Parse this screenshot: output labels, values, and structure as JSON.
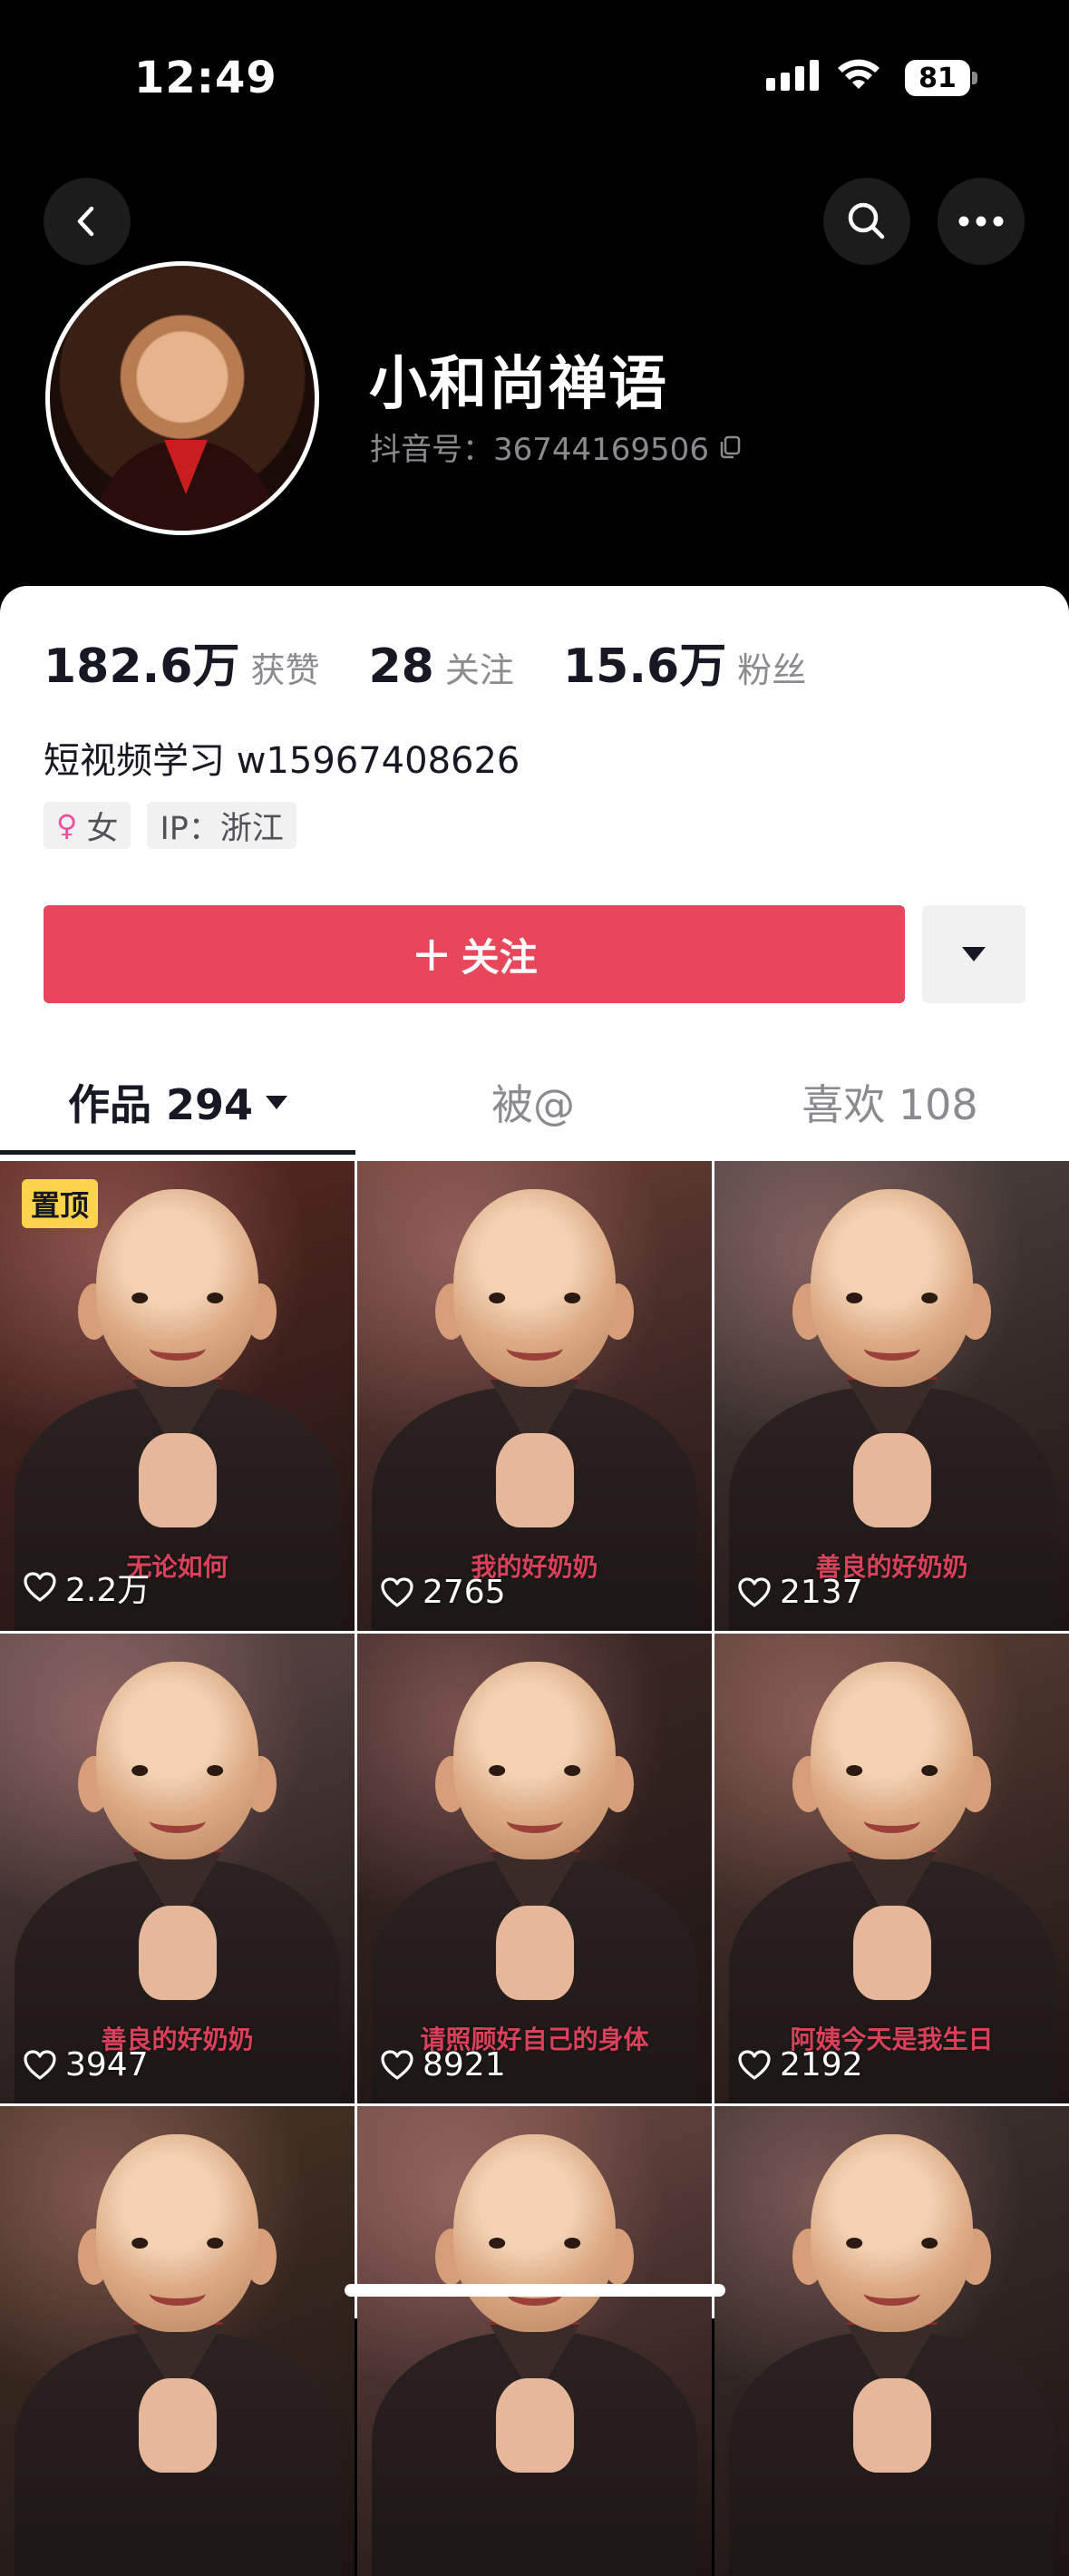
{
  "status_bar": {
    "time": "12:49",
    "battery": "81"
  },
  "profile": {
    "nickname": "小和尚禅语",
    "douyin_id": "抖音号：36744169506",
    "stats": [
      {
        "num": "182.6万",
        "label": "获赞"
      },
      {
        "num": "28",
        "label": "关注"
      },
      {
        "num": "15.6万",
        "label": "粉丝"
      }
    ],
    "bio": "短视频学习 w15967408626",
    "gender_tag": "女",
    "ip_tag": "IP：浙江",
    "follow_label": "关注"
  },
  "tabs": [
    {
      "label": "作品 294"
    },
    {
      "label": "被@"
    },
    {
      "label": "喜欢 108"
    }
  ],
  "videos": [
    {
      "likes": "2.2万",
      "caption": "无论如何",
      "pinned_label": "置顶",
      "bg": "#5a2a22"
    },
    {
      "likes": "2765",
      "caption": "我的好奶奶",
      "bg": "#6b4038"
    },
    {
      "likes": "2137",
      "caption": "善良的好奶奶",
      "bg": "#4e4440"
    },
    {
      "likes": "3947",
      "caption": "善良的好奶奶",
      "bg": "#5e4a48"
    },
    {
      "likes": "8921",
      "caption": "请照顾好自己的身体",
      "bg": "#3e2a26"
    },
    {
      "likes": "2192",
      "caption": "阿姨今天是我生日",
      "bg": "#5a3f34"
    },
    {
      "bg": "#4a3526"
    },
    {
      "bg": "#6e4a44"
    },
    {
      "bg": "#3e3430"
    }
  ],
  "colors": {
    "accent": "#e8465a",
    "pin": "#fcd34d",
    "muted": "#8a8b91"
  }
}
